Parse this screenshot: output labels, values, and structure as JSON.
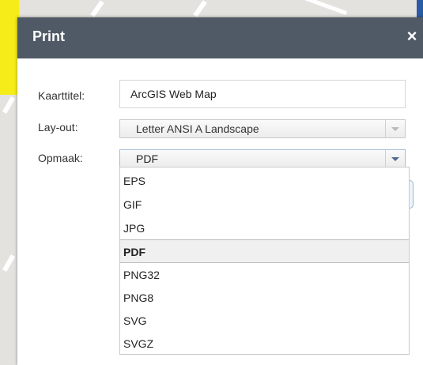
{
  "dialog": {
    "title": "Print",
    "close_label": "×"
  },
  "form": {
    "title_label": "Kaarttitel:",
    "title_value": "ArcGIS Web Map",
    "layout_label": "Lay-out:",
    "layout_value": "Letter ANSI A Landscape",
    "format_label": "Opmaak:",
    "format_value": "PDF"
  },
  "format_options": [
    "EPS",
    "GIF",
    "JPG",
    "PDF",
    "PNG32",
    "PNG8",
    "SVG",
    "SVGZ"
  ],
  "selected_option": "PDF",
  "colors": {
    "header": "#4f5a66",
    "map_yellow": "#f5ec1a",
    "map_edge": "#2b5aa8"
  }
}
